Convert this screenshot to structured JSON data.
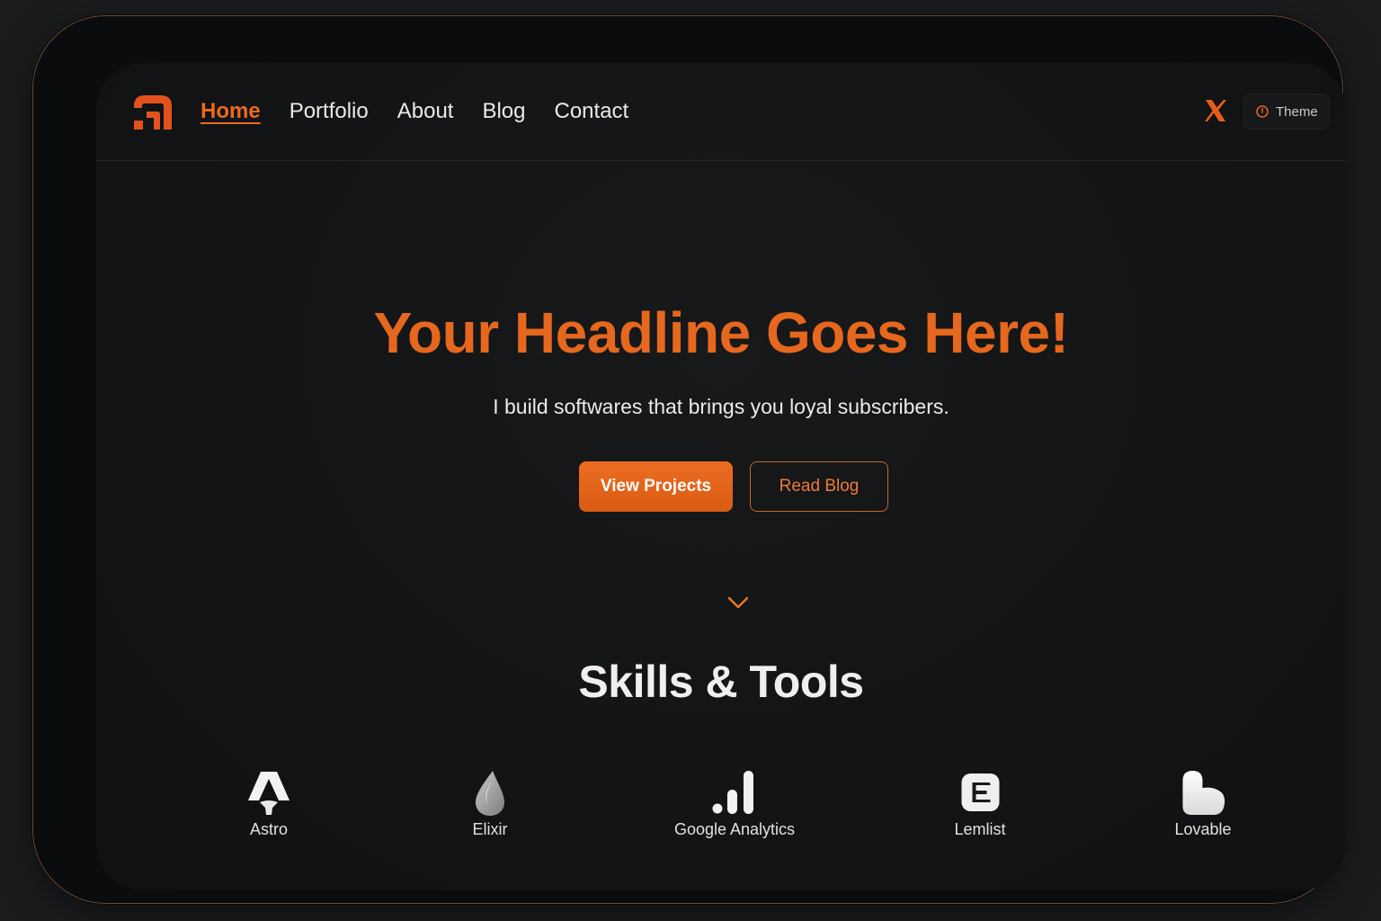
{
  "nav": {
    "links": [
      "Home",
      "Portfolio",
      "About",
      "Blog",
      "Contact"
    ],
    "active": "Home",
    "theme_label": "Theme",
    "social_icon": "x-icon"
  },
  "hero": {
    "title": "Your Headline Goes Here!",
    "subtitle": "I build softwares that brings you loyal subscribers.",
    "primary_button": "View Projects",
    "secondary_button": "Read Blog"
  },
  "skills": {
    "title": "Skills & Tools",
    "items": [
      {
        "label": "Astro",
        "icon": "astro-icon"
      },
      {
        "label": "Elixir",
        "icon": "elixir-icon"
      },
      {
        "label": "Google Analytics",
        "icon": "google-analytics-icon"
      },
      {
        "label": "Lemlist",
        "icon": "lemlist-icon"
      },
      {
        "label": "Lovable",
        "icon": "lovable-icon"
      }
    ]
  },
  "colors": {
    "accent": "#e6671e",
    "background": "#121416",
    "text": "#ecebe8"
  }
}
